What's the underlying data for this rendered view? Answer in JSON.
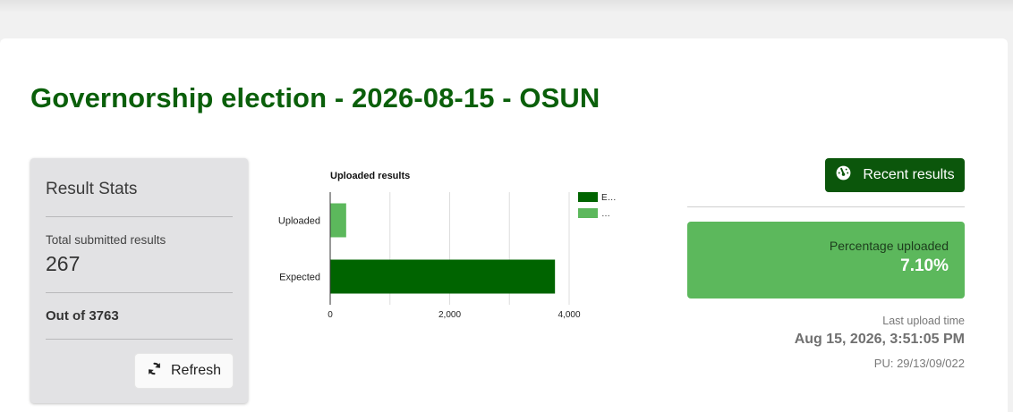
{
  "page": {
    "title": "Governorship election - 2026-08-15 - OSUN"
  },
  "stats": {
    "title": "Result Stats",
    "total_label": "Total submitted results",
    "total_value": "267",
    "out_of": "Out of 3763",
    "refresh_label": "Refresh",
    "refresh_icon": "refresh-icon"
  },
  "chart_data": {
    "type": "bar",
    "orientation": "horizontal",
    "title": "Uploaded results",
    "categories": [
      "Uploaded",
      "Expected"
    ],
    "values": [
      267,
      3763
    ],
    "colors": [
      "#5cb85c",
      "#006400"
    ],
    "xlim": [
      0,
      4000
    ],
    "xticks": [
      0,
      2000,
      4000
    ],
    "xtick_labels": [
      "0",
      "2,000",
      "4,000"
    ],
    "legend": {
      "placement": "right",
      "entries": [
        {
          "label": "E…",
          "color": "#006400"
        },
        {
          "label": "…",
          "color": "#5cb85c"
        }
      ]
    },
    "grid": true
  },
  "recent": {
    "label": "Recent results",
    "icon": "dashboard-gauge-icon"
  },
  "percentage": {
    "label": "Percentage uploaded",
    "value": "7.10%"
  },
  "upload": {
    "label": "Last upload time",
    "time": "Aug 15, 2026, 3:51:05 PM",
    "pu": "PU: 29/13/09/022"
  },
  "colors": {
    "brand_green": "#0a5f0a",
    "button_green": "#0b560b",
    "box_green": "#5cb85c"
  }
}
